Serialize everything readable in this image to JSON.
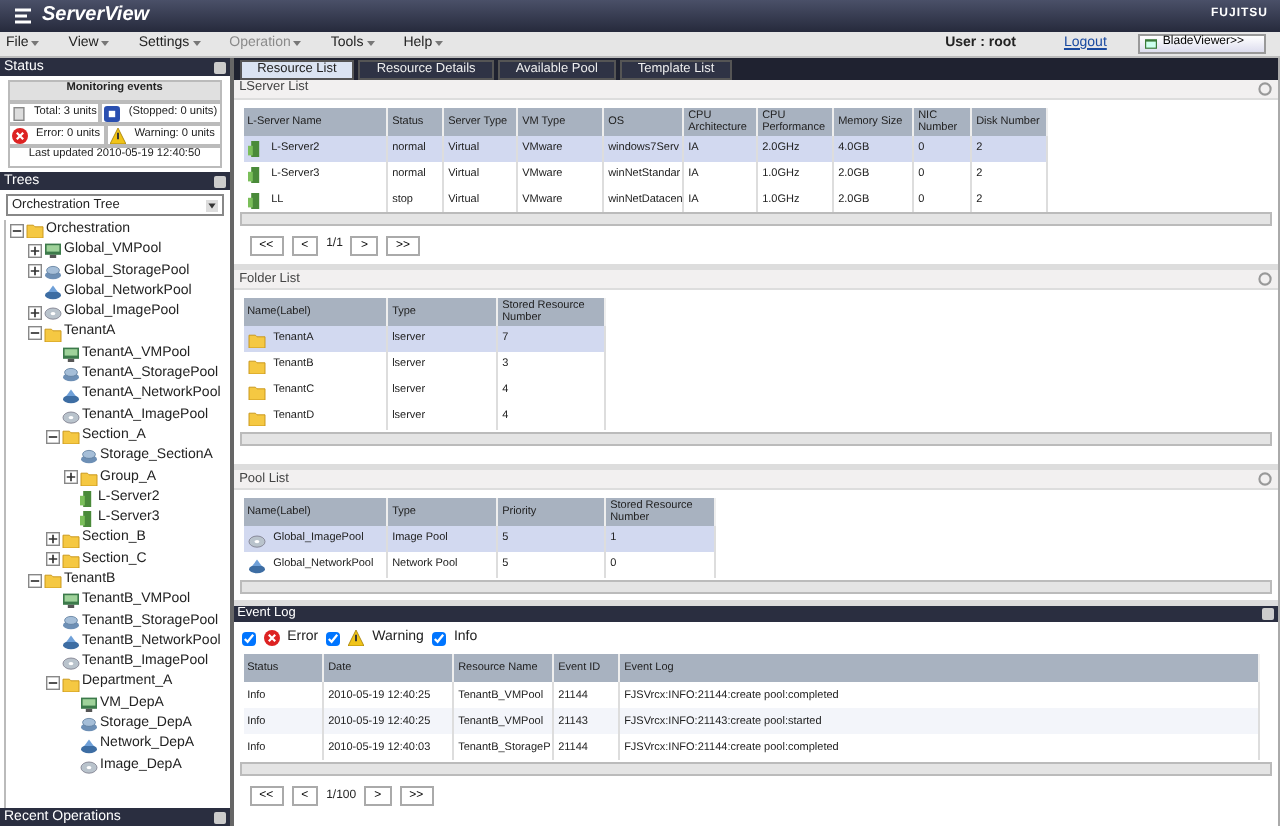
{
  "header": {
    "logo": "ServerView",
    "brand": "FUJITSU"
  },
  "menu": [
    {
      "label": "File",
      "disabled": false
    },
    {
      "label": "View",
      "disabled": false
    },
    {
      "label": "Settings",
      "disabled": false
    },
    {
      "label": "Operation",
      "disabled": true
    },
    {
      "label": "Tools",
      "disabled": false
    },
    {
      "label": "Help",
      "disabled": false
    }
  ],
  "user": "User : root",
  "logout": "Logout",
  "blade_viewer": "BladeViewer>>",
  "status_panel": {
    "title": "Status",
    "heading": "Monitoring events",
    "items": [
      {
        "kind": "total",
        "text": "Total: 3 units"
      },
      {
        "kind": "stopped",
        "text": "(Stopped: 0 units)"
      },
      {
        "kind": "error",
        "text": "Error: 0 units"
      },
      {
        "kind": "warning",
        "text": "Warning: 0 units"
      }
    ],
    "updated": "Last updated 2010-05-19 12:40:50"
  },
  "trees_panel": {
    "title": "Trees",
    "select": "Orchestration Tree",
    "tree": [
      {
        "label": "Orchestration",
        "kind": "folder",
        "expanded": true,
        "children": [
          {
            "label": "Global_VMPool",
            "kind": "vmpool",
            "expanded": false
          },
          {
            "label": "Global_StoragePool",
            "kind": "storagepool",
            "expanded": false
          },
          {
            "label": "Global_NetworkPool",
            "kind": "networkpool"
          },
          {
            "label": "Global_ImagePool",
            "kind": "imagepool",
            "expanded": false
          },
          {
            "label": "TenantA",
            "kind": "folder",
            "expanded": true,
            "children": [
              {
                "label": "TenantA_VMPool",
                "kind": "vmpool"
              },
              {
                "label": "TenantA_StoragePool",
                "kind": "storagepool"
              },
              {
                "label": "TenantA_NetworkPool",
                "kind": "networkpool"
              },
              {
                "label": "TenantA_ImagePool",
                "kind": "imagepool"
              },
              {
                "label": "Section_A",
                "kind": "folder",
                "expanded": true,
                "children": [
                  {
                    "label": "Storage_SectionA",
                    "kind": "storagepool"
                  },
                  {
                    "label": "Group_A",
                    "kind": "folder",
                    "expanded": false
                  },
                  {
                    "label": "L-Server2",
                    "kind": "server"
                  },
                  {
                    "label": "L-Server3",
                    "kind": "server"
                  }
                ]
              },
              {
                "label": "Section_B",
                "kind": "folder",
                "expanded": false
              },
              {
                "label": "Section_C",
                "kind": "folder",
                "expanded": false
              }
            ]
          },
          {
            "label": "TenantB",
            "kind": "folder",
            "expanded": true,
            "children": [
              {
                "label": "TenantB_VMPool",
                "kind": "vmpool"
              },
              {
                "label": "TenantB_StoragePool",
                "kind": "storagepool"
              },
              {
                "label": "TenantB_NetworkPool",
                "kind": "networkpool"
              },
              {
                "label": "TenantB_ImagePool",
                "kind": "imagepool"
              },
              {
                "label": "Department_A",
                "kind": "folder",
                "expanded": true,
                "children": [
                  {
                    "label": "VM_DepA",
                    "kind": "vmpool"
                  },
                  {
                    "label": "Storage_DepA",
                    "kind": "storagepool"
                  },
                  {
                    "label": "Network_DepA",
                    "kind": "networkpool"
                  },
                  {
                    "label": "Image_DepA",
                    "kind": "imagepool"
                  }
                ]
              }
            ]
          }
        ]
      }
    ]
  },
  "recent_operations": "Recent Operations",
  "tabs": [
    {
      "label": "Resource List",
      "selected": true
    },
    {
      "label": "Resource Details",
      "selected": false
    },
    {
      "label": "Available Pool",
      "selected": false
    },
    {
      "label": "Template List",
      "selected": false
    }
  ],
  "lserver_list": {
    "title": "LServer List",
    "columns": [
      "L-Server Name",
      "Status",
      "Server Type",
      "VM Type",
      "OS",
      "CPU Architecture",
      "CPU Performance",
      "Memory Size",
      "NIC Number",
      "Disk Number"
    ],
    "rows": [
      {
        "selected": true,
        "kind": "server",
        "cells": [
          "L-Server2",
          "normal",
          "Virtual",
          "VMware",
          "windows7Serv",
          "IA",
          "2.0GHz",
          "4.0GB",
          "0",
          "2"
        ]
      },
      {
        "selected": false,
        "kind": "server",
        "cells": [
          "L-Server3",
          "normal",
          "Virtual",
          "VMware",
          "winNetStandar",
          "IA",
          "1.0GHz",
          "2.0GB",
          "0",
          "2"
        ]
      },
      {
        "selected": false,
        "kind": "server",
        "cells": [
          "LL",
          "stop",
          "Virtual",
          "VMware",
          "winNetDatacen",
          "IA",
          "1.0GHz",
          "2.0GB",
          "0",
          "2"
        ]
      }
    ],
    "pager": [
      "<<",
      "<",
      "1/1",
      ">",
      ">>"
    ]
  },
  "folder_list": {
    "title": "Folder List",
    "columns": [
      "Name(Label)",
      "Type",
      "Stored Resource Number"
    ],
    "rows": [
      {
        "selected": true,
        "kind": "folder",
        "cells": [
          "TenantA",
          "lserver",
          "7"
        ]
      },
      {
        "selected": false,
        "kind": "folder",
        "cells": [
          "TenantB",
          "lserver",
          "3"
        ]
      },
      {
        "selected": false,
        "kind": "folder",
        "cells": [
          "TenantC",
          "lserver",
          "4"
        ]
      },
      {
        "selected": false,
        "kind": "folder",
        "cells": [
          "TenantD",
          "lserver",
          "4"
        ]
      }
    ]
  },
  "pool_list": {
    "title": "Pool List",
    "columns": [
      "Name(Label)",
      "Type",
      "Priority",
      "Stored Resource Number"
    ],
    "rows": [
      {
        "selected": true,
        "kind": "imagepool",
        "cells": [
          "Global_ImagePool",
          "Image Pool",
          "5",
          "1"
        ]
      },
      {
        "selected": false,
        "kind": "networkpool",
        "cells": [
          "Global_NetworkPool",
          "Network Pool",
          "5",
          "0"
        ]
      }
    ]
  },
  "event_log": {
    "title": "Event Log",
    "filters": [
      {
        "kind": "error",
        "label": "Error",
        "checked": true
      },
      {
        "kind": "warning",
        "label": "Warning",
        "checked": true
      },
      {
        "kind": "info",
        "label": "Info",
        "checked": true
      }
    ],
    "columns": [
      "Status",
      "Date",
      "Resource Name",
      "Event ID",
      "Event Log"
    ],
    "rows": [
      {
        "selected": false,
        "cells": [
          "Info",
          "2010-05-19 12:40:25",
          "TenantB_VMPool",
          "21144",
          "FJSVrcx:INFO:21144:create pool:completed"
        ]
      },
      {
        "selected": false,
        "cells": [
          "Info",
          "2010-05-19 12:40:25",
          "TenantB_VMPool",
          "21143",
          "FJSVrcx:INFO:21143:create pool:started"
        ]
      },
      {
        "selected": false,
        "cells": [
          "Info",
          "2010-05-19 12:40:03",
          "TenantB_StorageP",
          "21144",
          "FJSVrcx:INFO:21144:create pool:completed"
        ]
      }
    ],
    "pager": [
      "<<",
      "<",
      "1/100",
      ">",
      ">>"
    ]
  }
}
